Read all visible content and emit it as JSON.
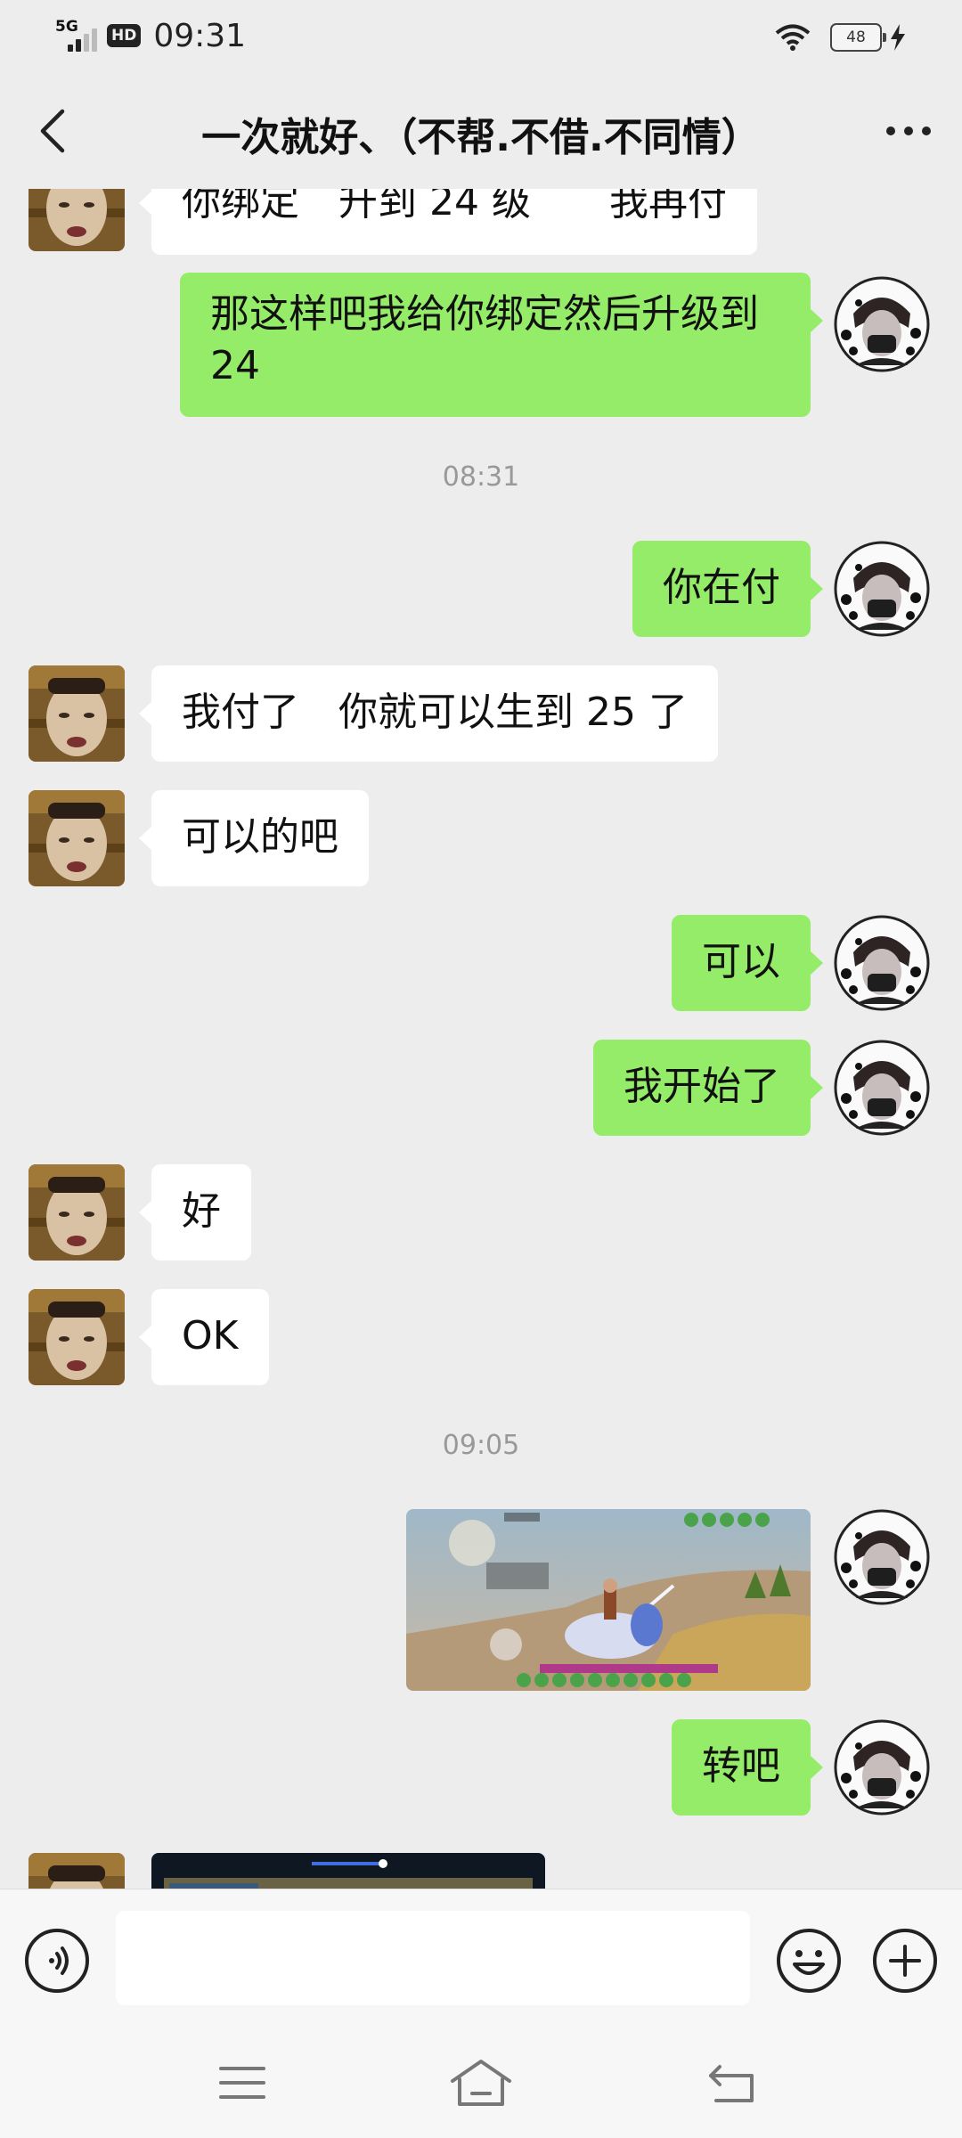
{
  "status_bar": {
    "network": "5G",
    "hd_badge": "HD",
    "time": "09:31",
    "battery": "48",
    "icons": [
      "signal-icon",
      "wifi-icon",
      "battery-icon",
      "charging-icon"
    ]
  },
  "header": {
    "title": "一次就好、（不帮.不借.不同情）",
    "icons": [
      "back-arrow-icon",
      "more-icon"
    ]
  },
  "messages": [
    {
      "side": "in",
      "type": "text",
      "text": "你绑定　升到 24 级　　我再付"
    },
    {
      "side": "out",
      "type": "text",
      "text": "那这样吧我给你绑定然后升级到24"
    },
    {
      "type": "time",
      "text": "08:31"
    },
    {
      "side": "out",
      "type": "text",
      "text": "你在付"
    },
    {
      "side": "in",
      "type": "text",
      "text": "我付了　你就可以生到 25 了"
    },
    {
      "side": "in",
      "type": "text",
      "text": "可以的吧"
    },
    {
      "side": "out",
      "type": "text",
      "text": "可以"
    },
    {
      "side": "out",
      "type": "text",
      "text": "我开始了"
    },
    {
      "side": "in",
      "type": "text",
      "text": "好"
    },
    {
      "side": "in",
      "type": "text",
      "text": "OK"
    },
    {
      "type": "time",
      "text": "09:05"
    },
    {
      "side": "out",
      "type": "image",
      "description": "game screenshot"
    },
    {
      "side": "out",
      "type": "text",
      "text": "转吧"
    },
    {
      "side": "in",
      "type": "image",
      "description": "game screenshot"
    }
  ],
  "input_bar": {
    "placeholder": "",
    "icons": [
      "voice-icon",
      "emoji-icon",
      "plus-icon"
    ]
  },
  "nav_bar": {
    "icons": [
      "menu-icon",
      "home-icon",
      "back-icon"
    ]
  },
  "colors": {
    "background": "#ededed",
    "outgoing_bubble": "#95ec69",
    "incoming_bubble": "#ffffff",
    "timestamp": "#999999"
  }
}
